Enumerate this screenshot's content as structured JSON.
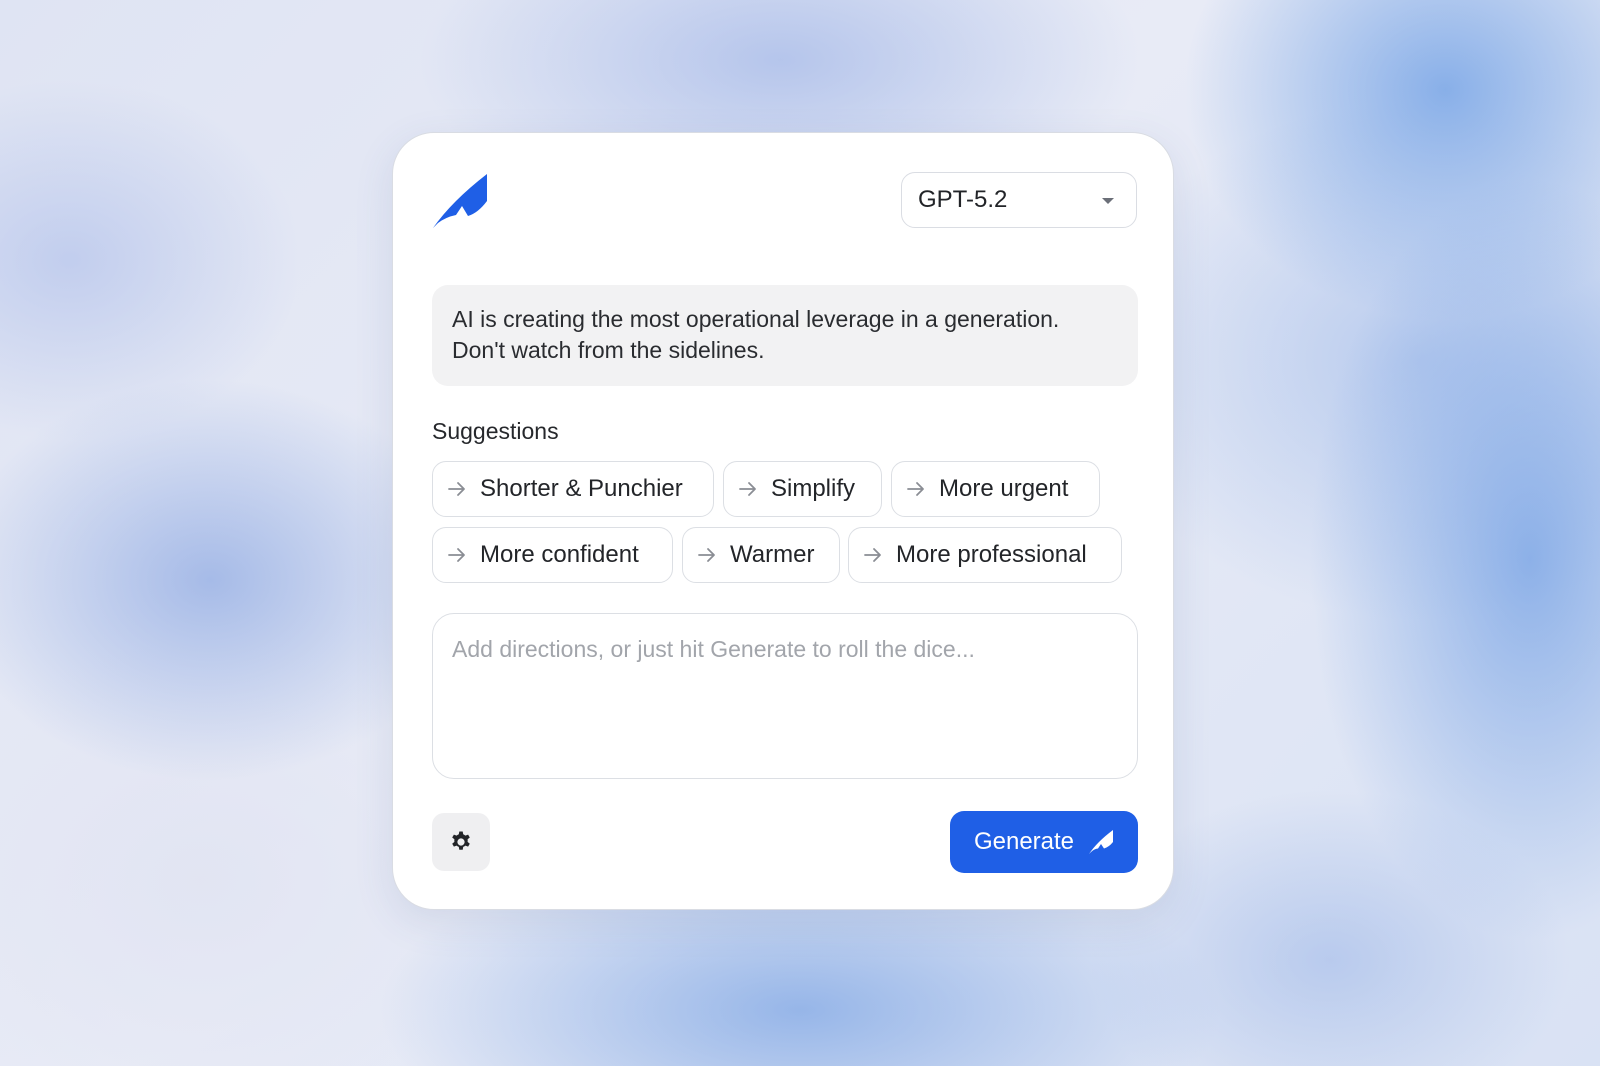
{
  "app": {
    "logo_icon": "quill-logo-icon",
    "accent_color": "#1f5fe6"
  },
  "model_selector": {
    "selected": "GPT-5.2",
    "icon": "chevron-down-icon"
  },
  "source_text": "AI is creating the most operational leverage in a generation. Don't watch from the sidelines.",
  "suggestions": {
    "heading": "Suggestions",
    "icon": "arrow-right-icon",
    "items": [
      {
        "label": "Shorter & Punchier"
      },
      {
        "label": "Simplify"
      },
      {
        "label": "More urgent"
      },
      {
        "label": "More confident"
      },
      {
        "label": "Warmer"
      },
      {
        "label": "More professional"
      }
    ]
  },
  "directions": {
    "value": "",
    "placeholder": "Add directions, or just hit Generate to roll the dice..."
  },
  "footer": {
    "settings_icon": "gear-icon",
    "generate_label": "Generate",
    "generate_icon": "quill-icon"
  }
}
